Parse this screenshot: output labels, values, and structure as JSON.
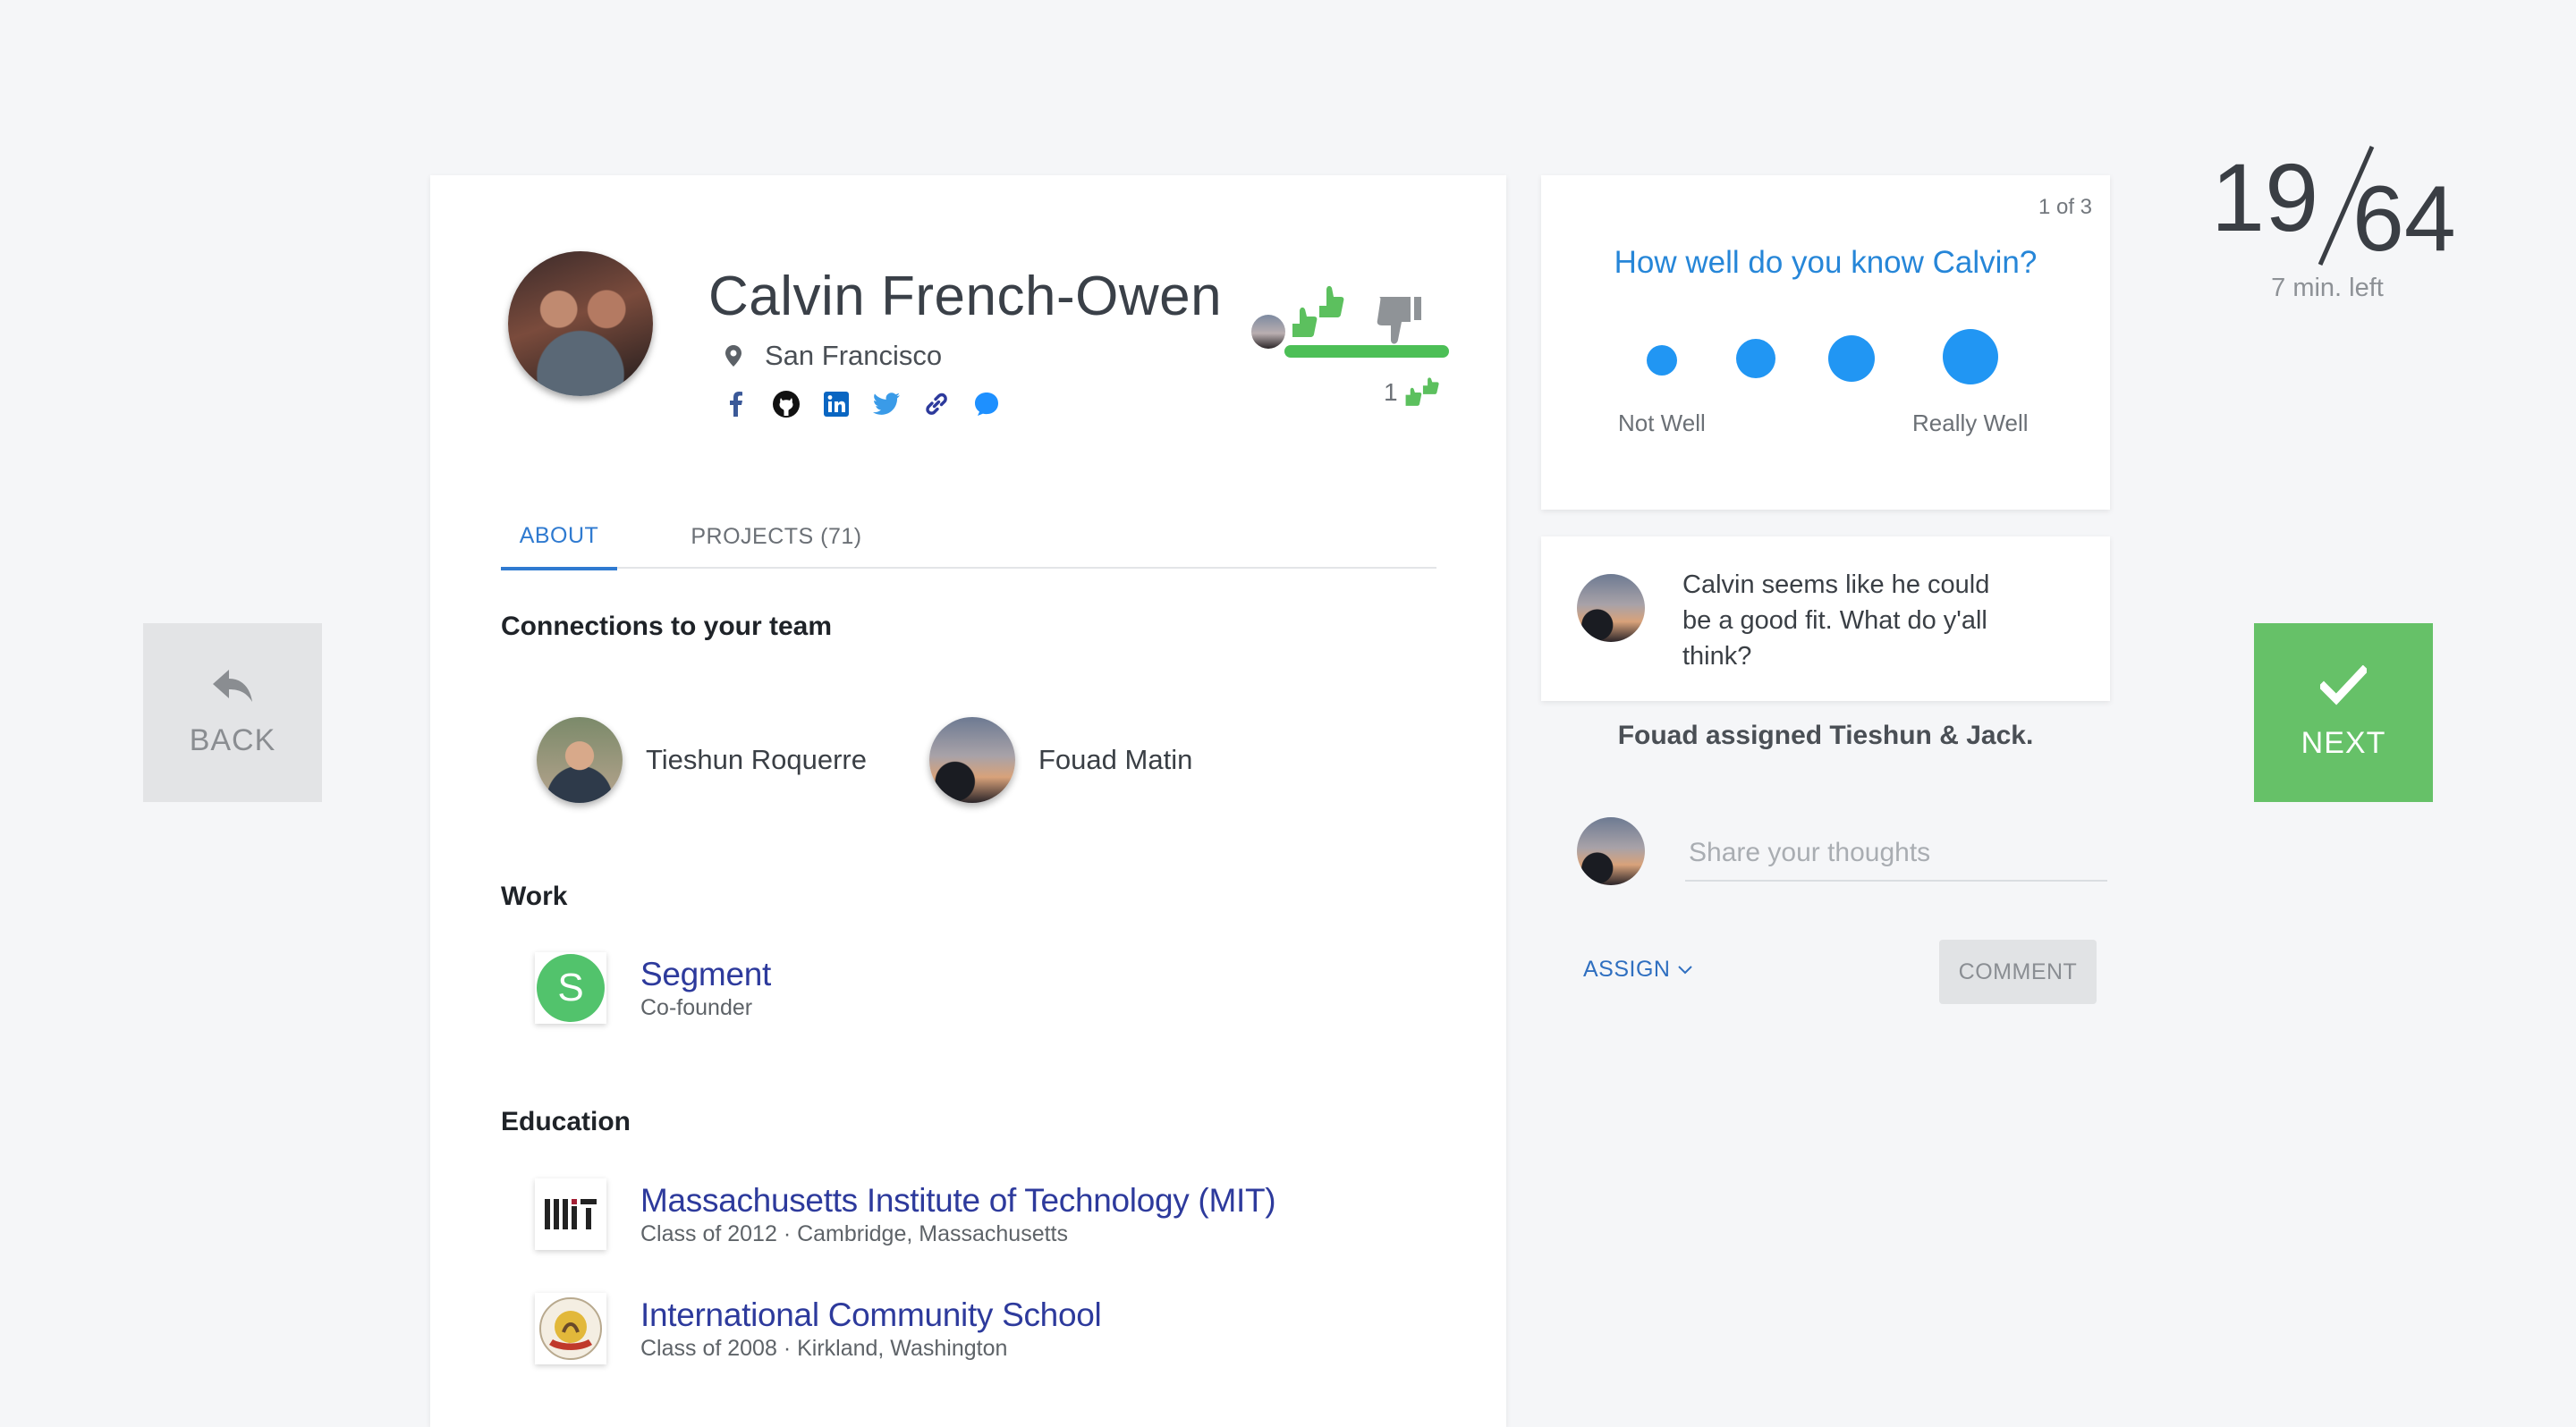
{
  "nav": {
    "back_label": "BACK",
    "next_label": "NEXT",
    "counter_current": "19",
    "counter_total": "64",
    "time_left": "7 min. left"
  },
  "profile": {
    "name": "Calvin French-Owen",
    "location": "San Francisco",
    "social_icons": [
      "facebook-icon",
      "github-icon",
      "linkedin-icon",
      "twitter-icon",
      "link-icon",
      "chat-icon"
    ],
    "vote_count": "1",
    "vote_up_ratio": 1.0
  },
  "tabs": {
    "about": "ABOUT",
    "projects": "PROJECTS (71)"
  },
  "connections": {
    "title": "Connections to your team",
    "people": [
      {
        "name": "Tieshun Roquerre"
      },
      {
        "name": "Fouad Matin"
      }
    ]
  },
  "work": {
    "title": "Work",
    "items": [
      {
        "name": "Segment",
        "sub": "Co-founder",
        "logo_letter": "S"
      }
    ]
  },
  "education": {
    "title": "Education",
    "items": [
      {
        "name": "Massachusetts Institute of Technology (MIT)",
        "sub": "Class of 2012 · Cambridge, Massachusetts"
      },
      {
        "name": "International Community School",
        "sub": "Class of 2008 · Kirkland, Washington"
      }
    ]
  },
  "rating": {
    "page_indicator": "1 of 3",
    "question": "How well do you know Calvin?",
    "low_label": "Not Well",
    "high_label": "Really Well",
    "options_count": 4
  },
  "discussion": {
    "comment": "Calvin seems like he could be a good fit. What do y'all think?",
    "assigned_note": "Fouad assigned Tieshun & Jack.",
    "input_placeholder": "Share your thoughts",
    "assign_label": "ASSIGN",
    "comment_button": "COMMENT"
  },
  "colors": {
    "accent_blue": "#2196f3",
    "next_green": "#66c168",
    "link_blue": "#2d3a9c",
    "vote_green": "#4cbf56"
  }
}
